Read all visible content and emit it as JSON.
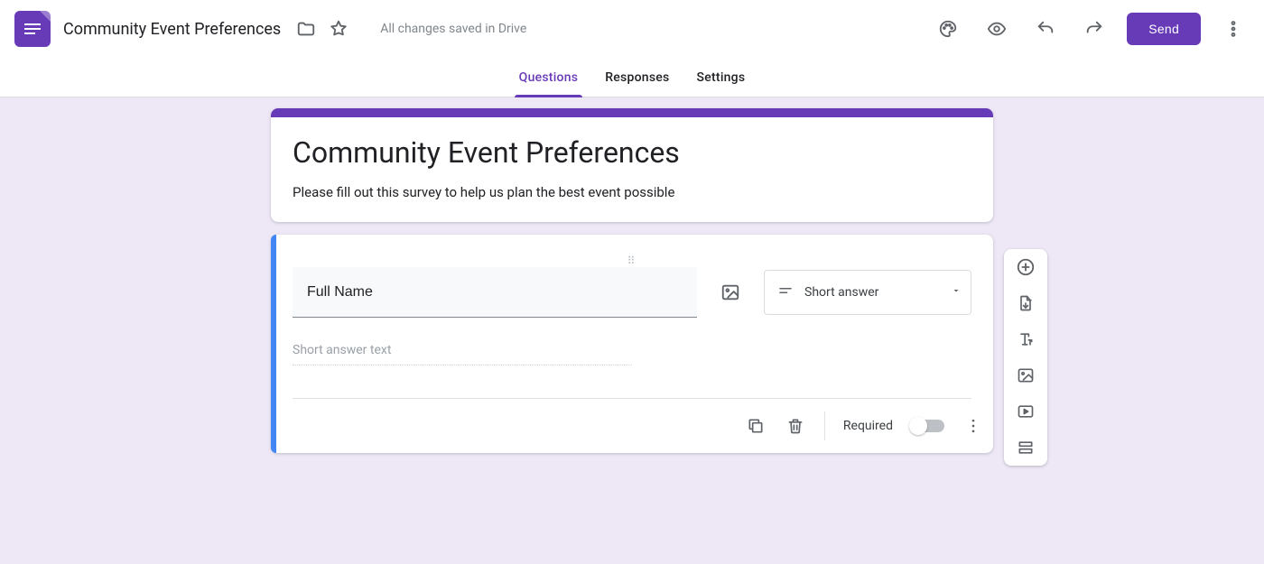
{
  "header": {
    "doc_title": "Community Event Preferences",
    "save_status": "All changes saved in Drive",
    "send_label": "Send"
  },
  "tabs": {
    "questions": "Questions",
    "responses": "Responses",
    "settings": "Settings",
    "active": "questions"
  },
  "form": {
    "title": "Community Event Preferences",
    "description": "Please fill out this survey to help us plan the best event possible"
  },
  "question": {
    "text": "Full Name",
    "type_label": "Short answer",
    "answer_placeholder": "Short answer text",
    "required_label": "Required",
    "required": false
  },
  "icons": {
    "folder": "folder-icon",
    "star": "star-icon",
    "palette": "palette-icon",
    "preview": "eye-icon",
    "undo": "undo-icon",
    "redo": "redo-icon",
    "more": "more-vert-icon",
    "image": "image-icon",
    "duplicate": "duplicate-icon",
    "delete": "delete-icon",
    "add_question": "add-circle-icon",
    "import": "import-icon",
    "add_title": "title-icon",
    "add_image": "image-icon",
    "add_video": "video-icon",
    "add_section": "section-icon"
  }
}
